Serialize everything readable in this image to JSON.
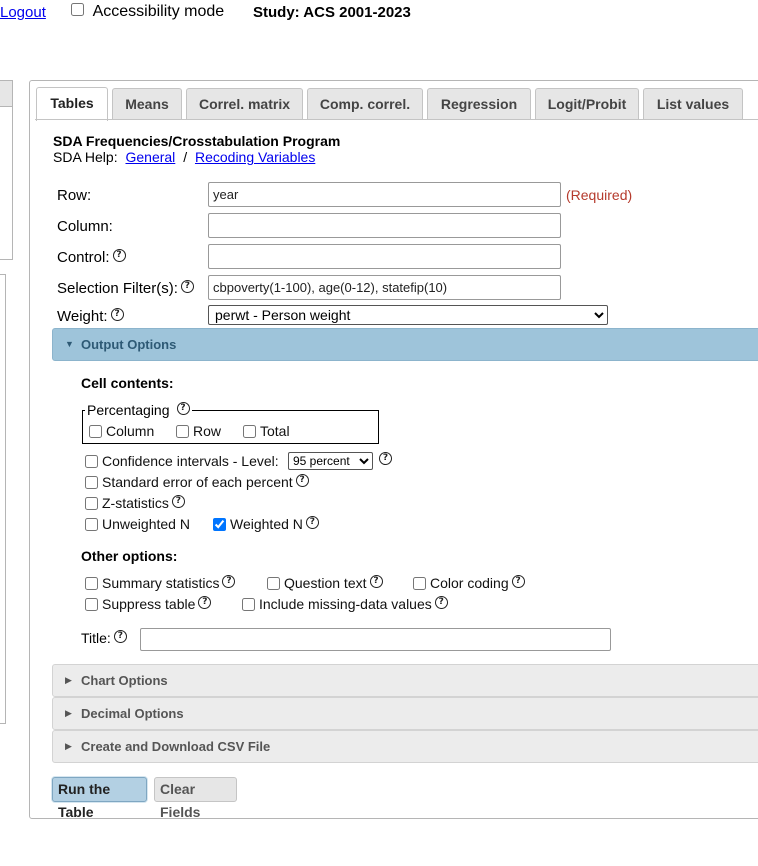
{
  "topbar": {
    "logout": "Logout",
    "accessibility_label": "Accessibility mode",
    "study": "Study: ACS 2001-2023"
  },
  "tabs": [
    "Tables",
    "Means",
    "Correl. matrix",
    "Comp. correl.",
    "Regression",
    "Logit/Probit",
    "List values"
  ],
  "program": {
    "title": "SDA Frequencies/Crosstabulation Program",
    "help_prefix": "SDA Help:",
    "help_general": "General",
    "help_sep": "/",
    "help_recoding": "Recoding Variables"
  },
  "form": {
    "row_label": "Row:",
    "row_value": "year",
    "required": "(Required)",
    "column_label": "Column:",
    "column_value": "",
    "control_label": "Control:",
    "control_value": "",
    "filter_label": "Selection Filter(s):",
    "filter_value": "cbpoverty(1-100), age(0-12), statefip(10)",
    "weight_label": "Weight:",
    "weight_value": "perwt - Person weight"
  },
  "output_options": {
    "header": "Output Options",
    "cell_contents": "Cell contents:",
    "percentaging": "Percentaging",
    "pct_column": "Column",
    "pct_row": "Row",
    "pct_total": "Total",
    "ci_label": "Confidence intervals - Level:",
    "ci_level": "95 percent",
    "std_error": "Standard error of each percent",
    "z_stats": "Z-statistics",
    "unweighted_n": "Unweighted N",
    "weighted_n": "Weighted N",
    "weighted_n_checked": true,
    "other_options": "Other options:",
    "summary_stats": "Summary statistics",
    "question_text": "Question text",
    "color_coding": "Color coding",
    "suppress_table": "Suppress table",
    "include_missing": "Include missing-data values",
    "title_label": "Title:",
    "title_value": ""
  },
  "sections": {
    "chart": "Chart Options",
    "decimal": "Decimal Options",
    "csv": "Create and Download CSV File"
  },
  "buttons": {
    "run": "Run the Table",
    "clear": "Clear Fields"
  },
  "icons": {
    "help": "help-circle-icon",
    "help_glyph": "?",
    "expanded": "triangle-down-icon",
    "collapsed": "triangle-right-icon"
  }
}
